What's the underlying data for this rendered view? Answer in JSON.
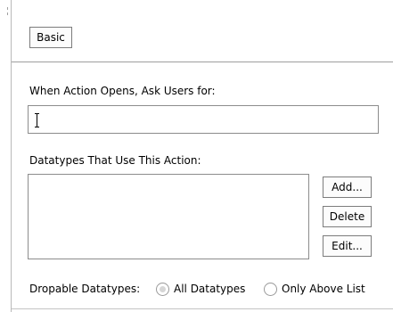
{
  "tab": {
    "label": "Basic"
  },
  "ask_users": {
    "label": "When Action Opens, Ask Users for:",
    "value": ""
  },
  "datatypes": {
    "label": "Datatypes That Use This Action:",
    "items": [],
    "add_label": "Add...",
    "delete_label": "Delete",
    "edit_label": "Edit..."
  },
  "dropable": {
    "label": "Dropable Datatypes:",
    "options": [
      {
        "label": "All Datatypes",
        "selected": true
      },
      {
        "label": "Only Above List",
        "selected": false
      }
    ]
  }
}
